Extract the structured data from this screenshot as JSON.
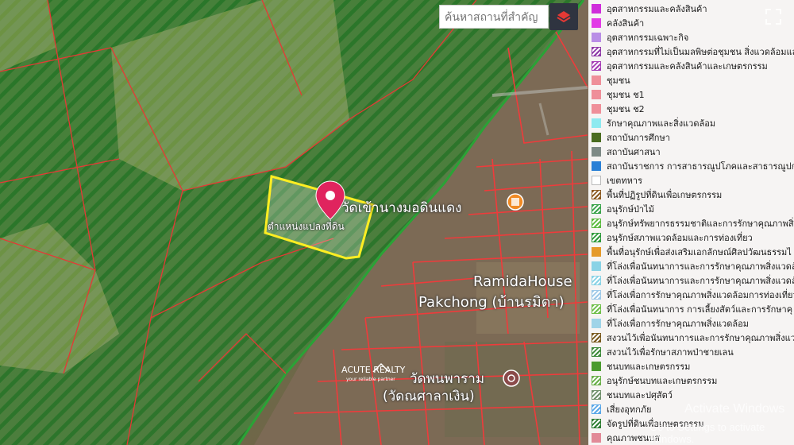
{
  "search": {
    "placeholder": "ค้นหาสถานที่สำคัญ"
  },
  "map_labels": {
    "pin_label": "ตำแหน่งแปลงที่ดิน",
    "place_top": "วัดเข้านางมอดินแดง",
    "place_mid_1": "RamidaHouse",
    "place_mid_2": "Pakchong (บ้านรมิดา)",
    "place_bottom_1": "วัดพนพาราม",
    "place_bottom_2": "(วัดณศาลาเงิน)",
    "logo_text": "ACUTE REALTY",
    "logo_tagline": "your reliable partner"
  },
  "watermark": {
    "line1": "Activate Windows",
    "line2": "Go to Settings to activate Windows."
  },
  "legend": [
    {
      "label": "อุตสาหกรรมและคลังสินค้า",
      "color": "#d02ddb",
      "pattern": "solid"
    },
    {
      "label": "คลังสินค้า",
      "color": "#e23be6",
      "pattern": "solid"
    },
    {
      "label": "อุตสาหกรรมเฉพาะกิจ",
      "color": "#b98ee6",
      "pattern": "solid"
    },
    {
      "label": "อุตสาหกรรมที่ไม่เป็นมลพิษต่อชุมชน สิ่งแวดล้อมและ",
      "color": "#8f3ba8",
      "pattern": "hatch"
    },
    {
      "label": "อุตสาหกรรมและคลังสินค้าและเกษตรกรรม",
      "color": "#a63db5",
      "pattern": "hatch"
    },
    {
      "label": "ชุมชน",
      "color": "#ef8f99",
      "pattern": "solid"
    },
    {
      "label": "ชุมชน ช1",
      "color": "#ef8f99",
      "pattern": "solid"
    },
    {
      "label": "ชุมชน ช2",
      "color": "#ef8f99",
      "pattern": "solid"
    },
    {
      "label": "รักษาคุณภาพและสิ่งแวดล้อม",
      "color": "#8eeaf0",
      "pattern": "solid"
    },
    {
      "label": "สถาบันการศึกษา",
      "color": "#4a6c20",
      "pattern": "solid"
    },
    {
      "label": "สถาบันศาสนา",
      "color": "#7e8a86",
      "pattern": "solid"
    },
    {
      "label": "สถาบันราชการ การสาธารณูปโภคและสาธารณูปการ",
      "color": "#2a80d6",
      "pattern": "solid"
    },
    {
      "label": "เขตทหาร",
      "color": "#ffffff",
      "pattern": "solid"
    },
    {
      "label": "พื้นที่ปฏิรูปที่ดินเพื่อเกษตรกรรม",
      "color": "#8b5a22",
      "pattern": "hatch"
    },
    {
      "label": "อนุรักษ์ป่าไม้",
      "color": "#3aa34a",
      "pattern": "hatch"
    },
    {
      "label": "อนุรักษ์ทรัพยากรธรรมชาติและการรักษาคุณภาพสิ่ง",
      "color": "#5bbb3e",
      "pattern": "hatch"
    },
    {
      "label": "อนุรักษ์สภาพแวดล้อมและการท่องเที่ยว",
      "color": "#2f9a3c",
      "pattern": "hatch"
    },
    {
      "label": "พื้นที่อนุรักษ์เพื่อส่งเสริมเอกลักษณ์ศิลปวัฒนธรรมไ",
      "color": "#e59a2a",
      "pattern": "solid"
    },
    {
      "label": "ที่โล่งเพื่อนันทนาการและการรักษาคุณภาพสิ่งแวดล้",
      "color": "#8ad3e6",
      "pattern": "solid"
    },
    {
      "label": "ที่โล่งเพื่อนันทนาการและการรักษาคุณภาพสิ่งแวดล้",
      "color": "#8ad3e6",
      "pattern": "hatch"
    },
    {
      "label": "ที่โล่งเพื่อการรักษาคุณภาพสิ่งแวดล้อมการท่องเที่ยว",
      "color": "#9ec9e8",
      "pattern": "hatch"
    },
    {
      "label": "ที่โล่งเพื่อนันทนาการ การเลี้ยงสัตว์และการรักษาคุ",
      "color": "#6fbf4a",
      "pattern": "hatch"
    },
    {
      "label": "ที่โล่งเพื่อการรักษาคุณภาพสิ่งแวดล้อม",
      "color": "#9fd4e8",
      "pattern": "solid"
    },
    {
      "label": "สงวนไว้เพื่อนันทนาการและการรักษาคุณภาพสิ่งแวด",
      "color": "#7a5a1e",
      "pattern": "hatch"
    },
    {
      "label": "สงวนไว้เพื่อรักษาสภาพป่าชายเลน",
      "color": "#3d8a3a",
      "pattern": "hatch"
    },
    {
      "label": "ชนบทและเกษตรกรรม",
      "color": "#4a9b2e",
      "pattern": "solid"
    },
    {
      "label": "อนุรักษ์ชนบทและเกษตรกรรม",
      "color": "#6ab04a",
      "pattern": "hatch"
    },
    {
      "label": "ชนบทและปศุสัตว์",
      "color": "#6e8f6a",
      "pattern": "hatch"
    },
    {
      "label": "เสี่ยงอุทกภัย",
      "color": "#5aa7e8",
      "pattern": "hatch"
    },
    {
      "label": "จัดรูปที่ดินเพื่อเกษตรกรรม",
      "color": "#2e7d32",
      "pattern": "hatch"
    },
    {
      "label": "คุณภาพชนบส",
      "color": "#e28a98",
      "pattern": "solid"
    }
  ]
}
